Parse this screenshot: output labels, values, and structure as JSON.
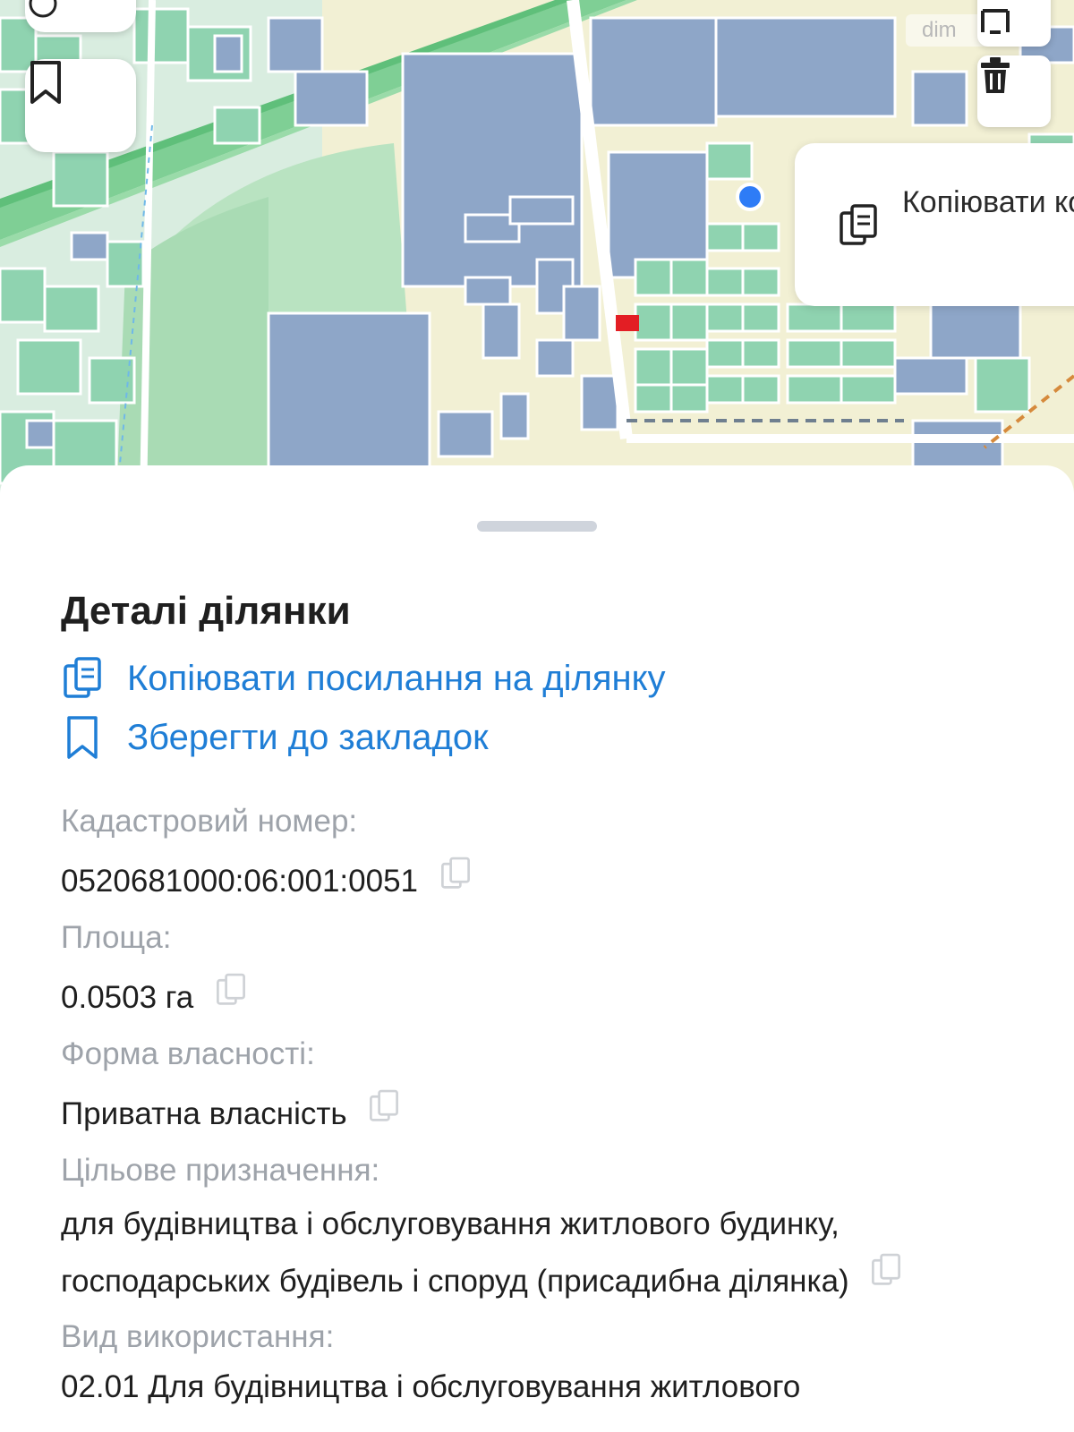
{
  "map": {
    "watermark": "dim",
    "copy_coordinates_label": "Копіювати координати"
  },
  "sheet": {
    "title": "Деталі ділянки",
    "actions": {
      "copy_link": "Копіювати посилання на ділянку",
      "save_bookmark": "Зберегти до закладок"
    },
    "fields": {
      "cadastral_label": "Кадастровий номер:",
      "cadastral_value": "0520681000:06:001:0051",
      "area_label": "Площа:",
      "area_value": "0.0503 га",
      "ownership_label": "Форма власності:",
      "ownership_value": "Приватна власність",
      "purpose_label": "Цільове призначення:",
      "purpose_line1": "для будівництва і обслуговування житлового будинку,",
      "purpose_line2": "господарських будівель і споруд (присадибна ділянка)",
      "usage_label": "Вид використання:",
      "usage_line1": "02.01 Для будівництва і обслуговування житлового"
    }
  },
  "colors": {
    "accent_blue": "#1f7ed6",
    "label_gray": "#9ea3aa",
    "parcel_green": "#8fd3b0",
    "building_blue": "#8ea6c8",
    "highlight_red": "#e31e24",
    "location_dot": "#2e7cf6"
  },
  "icons": {
    "locate": "locate-icon",
    "bookmark": "bookmark-icon",
    "delete": "trash-icon",
    "copy": "copy-icon"
  }
}
